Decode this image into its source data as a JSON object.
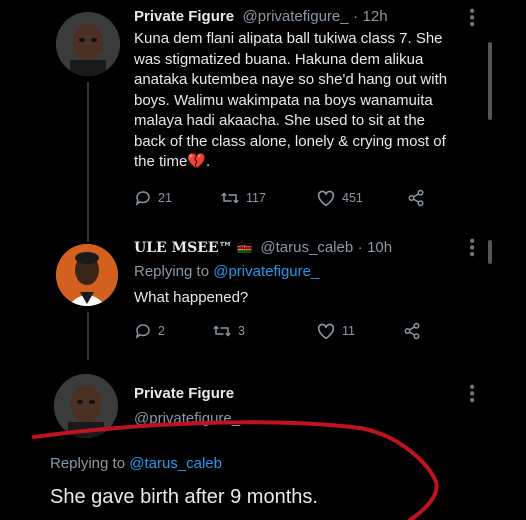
{
  "tweet1": {
    "display_name": "Private Figure",
    "handle": "@privatefigure_",
    "separator": "·",
    "time": "12h",
    "lines": [
      "Kuna dem flani alipata ball tukiwa class 7. She",
      "was stigmatized buana. Hakuna dem alikua",
      "anataka kutembea naye so she'd hang out with",
      "boys. Walimu wakimpata na boys wanamuita",
      "malaya hadi akaacha. She used to sit at the",
      "back of the class alone, lonely & crying most of",
      "the time💔."
    ],
    "replies": "21",
    "retweets": "117",
    "likes": "451"
  },
  "tweet2": {
    "display_name": "ULE MSEE™",
    "flag": "🇰🇪",
    "handle": "@tarus_caleb",
    "separator": "·",
    "time": "10h",
    "replying_prefix": "Replying to",
    "replying_handle": "@privatefigure_",
    "text": "What happened?",
    "replies": "2",
    "retweets": "3",
    "likes": "11"
  },
  "tweet3": {
    "display_name": "Private Figure",
    "handle": "@privatefigure_",
    "replying_prefix": "Replying to",
    "replying_handle": "@tarus_caleb",
    "text": "She gave birth after 9 months."
  },
  "colors": {
    "background": "#000000",
    "text": "#e7e9ea",
    "secondary": "#8b98a5",
    "annotation": "#c1121f"
  }
}
